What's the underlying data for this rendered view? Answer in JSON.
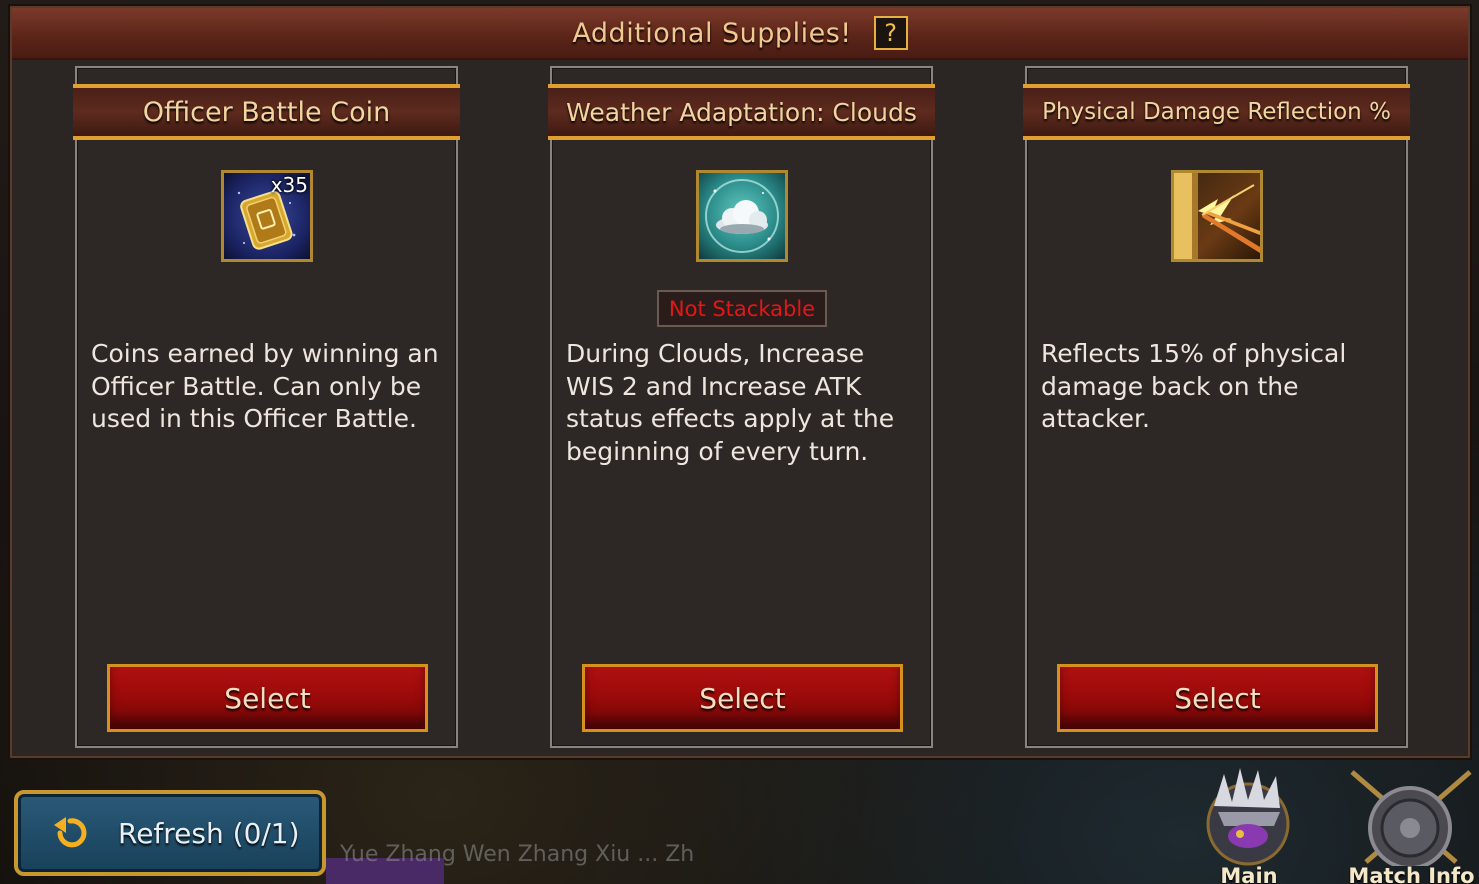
{
  "dialog": {
    "title": "Additional Supplies!",
    "help_label": "?"
  },
  "cards": [
    {
      "title": "Officer Battle Coin",
      "icon": "officer-battle-coin-icon",
      "quantity": "x35",
      "badge": "",
      "description": "Coins earned by winning an Officer Battle. Can only be used in this Officer Battle.",
      "button": "Select"
    },
    {
      "title": "Weather Adaptation: Clouds",
      "icon": "clouds-icon",
      "quantity": "",
      "badge": "Not Stackable",
      "description": "During Clouds, Increase WIS 2 and Increase ATK status effects apply at the beginning of every turn.",
      "button": "Select"
    },
    {
      "title": "Physical Damage Reflection %",
      "icon": "damage-reflection-icon",
      "quantity": "",
      "badge": "",
      "description": "Reflects 15% of physical damage back on the attacker.",
      "button": "Select"
    }
  ],
  "footer": {
    "refresh_label": "Refresh (0/1)",
    "background_names": "Yue   Zhang Wen   Zhang Xiu   ...   Zh",
    "nav": [
      {
        "label": "Main",
        "icon": "main-icon"
      },
      {
        "label": "Match Info",
        "icon": "shield-icon"
      }
    ]
  },
  "colors": {
    "header_bg": "#5a2418",
    "gold_trim": "#e0a030",
    "button_red": "#9a0a0a",
    "badge_red": "#e01818",
    "refresh_blue": "#2a5a78"
  }
}
